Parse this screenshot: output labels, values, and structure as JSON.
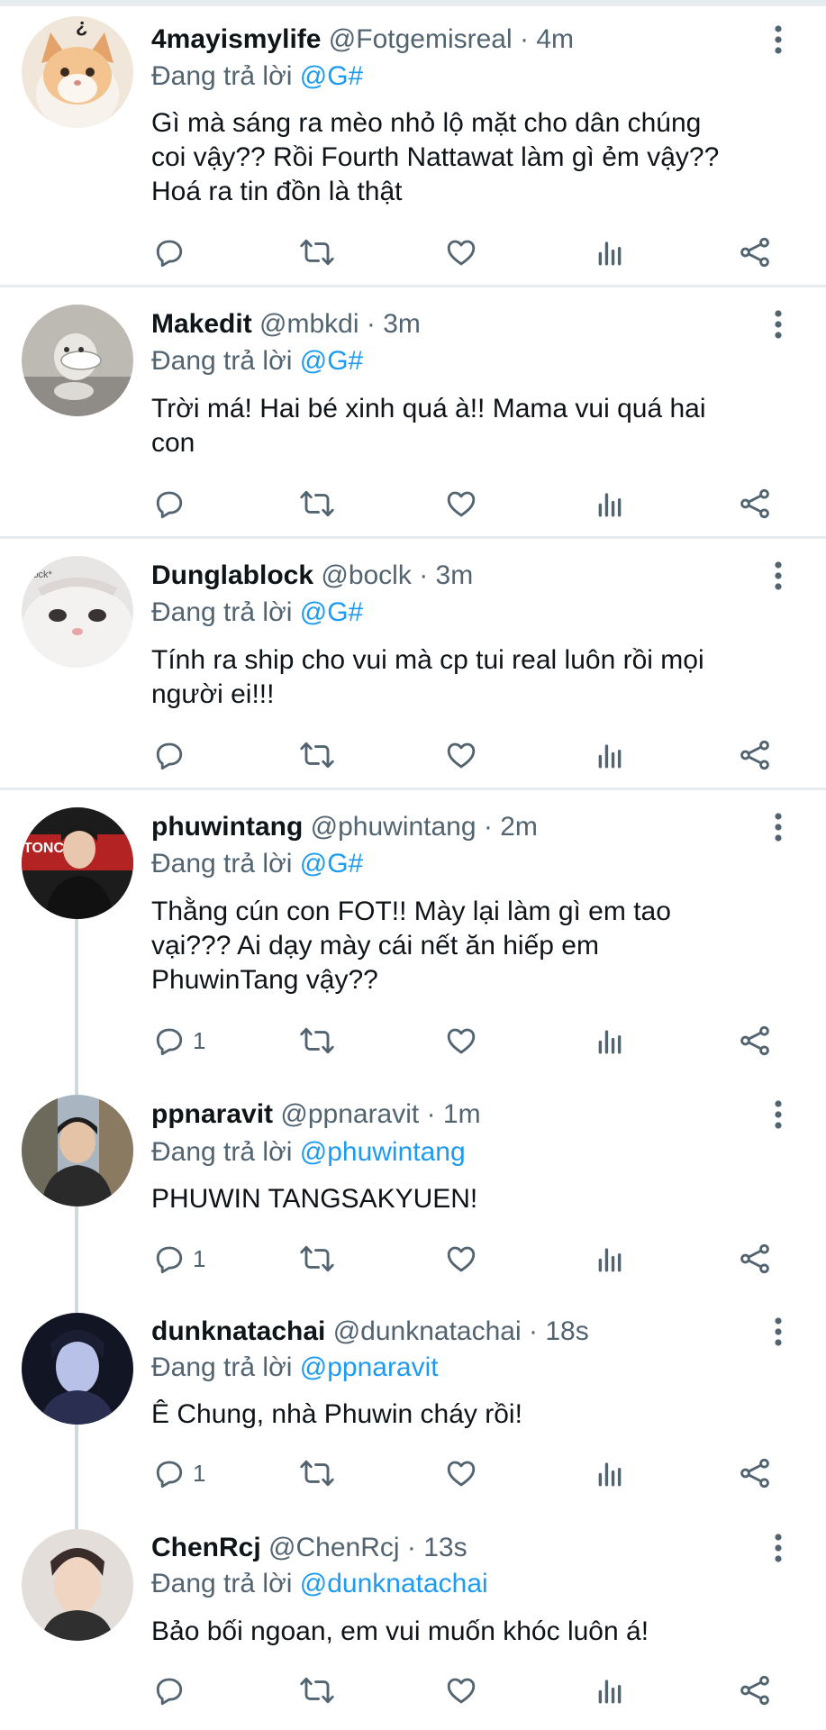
{
  "reply_prefix": "Đang trả lời",
  "tweets": [
    {
      "name": "4mayismylife",
      "handle": "@Fotgemisreal",
      "time": "· 4m",
      "reply_to": "@G#",
      "text_lines": [
        "Gì mà sáng ra mèo nhỏ lộ mặt cho dân chúng",
        "coi vậy?? Rồi Fourth Nattawat làm gì ẻm vậy??",
        "Hoá ra tin đồn là thật"
      ],
      "reply_count": ""
    },
    {
      "name": "Makedit",
      "handle": "@mbkdi",
      "time": "· 3m",
      "reply_to": "@G#",
      "text_lines": [
        "Trời má! Hai bé xinh quá à!! Mama vui quá hai",
        "con"
      ],
      "reply_count": ""
    },
    {
      "name": "Dunglablock",
      "handle": "@boclk",
      "time": "· 3m",
      "reply_to": "@G#",
      "text_lines": [
        "Tính ra ship cho vui mà cp tui real luôn rồi mọi",
        "người ei!!!"
      ],
      "reply_count": "",
      "avatar_text": "lock*"
    },
    {
      "name": "phuwintang",
      "handle": "@phuwintang",
      "time": "· 2m",
      "reply_to": "@G#",
      "text_lines": [
        "Thằng cún con FOT!! Mày lại làm gì em tao",
        "vại??? Ai dạy mày cái nết ăn hiếp em",
        "PhuwinTang vậy??"
      ],
      "reply_count": "1",
      "avatar_text": "TONCR"
    },
    {
      "name": "ppnaravit",
      "handle": "@ppnaravit",
      "time": "· 1m",
      "reply_to": "@phuwintang",
      "text_lines": [
        "PHUWIN TANGSAKYUEN!"
      ],
      "reply_count": "1"
    },
    {
      "name": "dunknatachai",
      "handle": "@dunknatachai",
      "time": "· 18s",
      "reply_to": "@ppnaravit",
      "text_lines": [
        "Ê Chung, nhà Phuwin cháy rồi!"
      ],
      "reply_count": "1"
    },
    {
      "name": "ChenRcj",
      "handle": "@ChenRcj",
      "time": "· 13s",
      "reply_to": "@dunknatachai",
      "text_lines": [
        "Bảo bối ngoan, em vui muốn khóc luôn á!"
      ],
      "reply_count": ""
    }
  ],
  "colors": {
    "text": "#0f1419",
    "secondary": "#536471",
    "link": "#1d9bf0",
    "separator": "#e6ecf0",
    "thread_line": "#cfd9de"
  },
  "icons": [
    "reply-icon",
    "retweet-icon",
    "like-icon",
    "analytics-icon",
    "share-icon",
    "more-icon"
  ]
}
